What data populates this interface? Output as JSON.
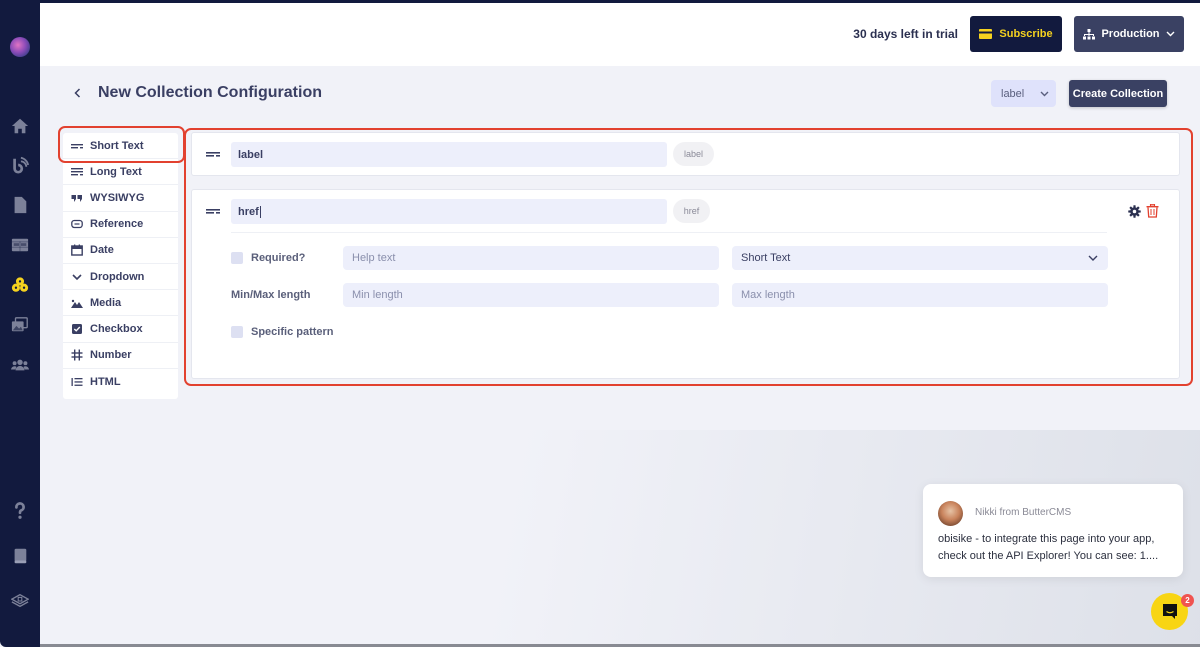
{
  "sidebar": {
    "items": [
      {
        "name": "home",
        "icon": "home-icon"
      },
      {
        "name": "blog",
        "icon": "blog-icon"
      },
      {
        "name": "pages",
        "icon": "page-icon"
      },
      {
        "name": "components",
        "icon": "grid-icon"
      },
      {
        "name": "collections",
        "icon": "collections-icon",
        "active": true
      },
      {
        "name": "media",
        "icon": "media-icon"
      },
      {
        "name": "users",
        "icon": "users-icon"
      }
    ],
    "bottom_items": [
      {
        "name": "help",
        "icon": "help-icon"
      },
      {
        "name": "docs",
        "icon": "book-icon"
      },
      {
        "name": "api",
        "icon": "api-icon"
      }
    ],
    "active_color": "#f5d21f"
  },
  "header": {
    "trial_text": "30 days left in trial",
    "subscribe_label": "Subscribe",
    "environment_label": "Production"
  },
  "page": {
    "title": "New Collection Configuration",
    "label_select_value": "label",
    "create_button_label": "Create Collection"
  },
  "field_types": [
    {
      "label": "Short Text",
      "icon": "short-text-icon"
    },
    {
      "label": "Long Text",
      "icon": "long-text-icon"
    },
    {
      "label": "WYSIWYG",
      "icon": "quote-icon"
    },
    {
      "label": "Reference",
      "icon": "link-icon"
    },
    {
      "label": "Date",
      "icon": "calendar-icon"
    },
    {
      "label": "Dropdown",
      "icon": "chevron-down-icon"
    },
    {
      "label": "Media",
      "icon": "image-icon"
    },
    {
      "label": "Checkbox",
      "icon": "checkbox-icon"
    },
    {
      "label": "Number",
      "icon": "hash-icon"
    },
    {
      "label": "HTML",
      "icon": "list-icon"
    }
  ],
  "fields": [
    {
      "name": "label",
      "key": "label"
    },
    {
      "name": "href",
      "key": "href",
      "options": {
        "required_label": "Required?",
        "help_text_placeholder": "Help text",
        "type_value": "Short Text",
        "minmax_label": "Min/Max length",
        "min_placeholder": "Min length",
        "max_placeholder": "Max length",
        "pattern_label": "Specific pattern"
      }
    }
  ],
  "chat": {
    "from": "Nikki from ButterCMS",
    "message": "obisike - to integrate this page into your app, check out the API Explorer! You can see: 1....",
    "badge_count": "2"
  },
  "colors": {
    "highlight": "#e2412f",
    "navy": "#121a3e",
    "accent_yellow": "#f5d21f"
  }
}
